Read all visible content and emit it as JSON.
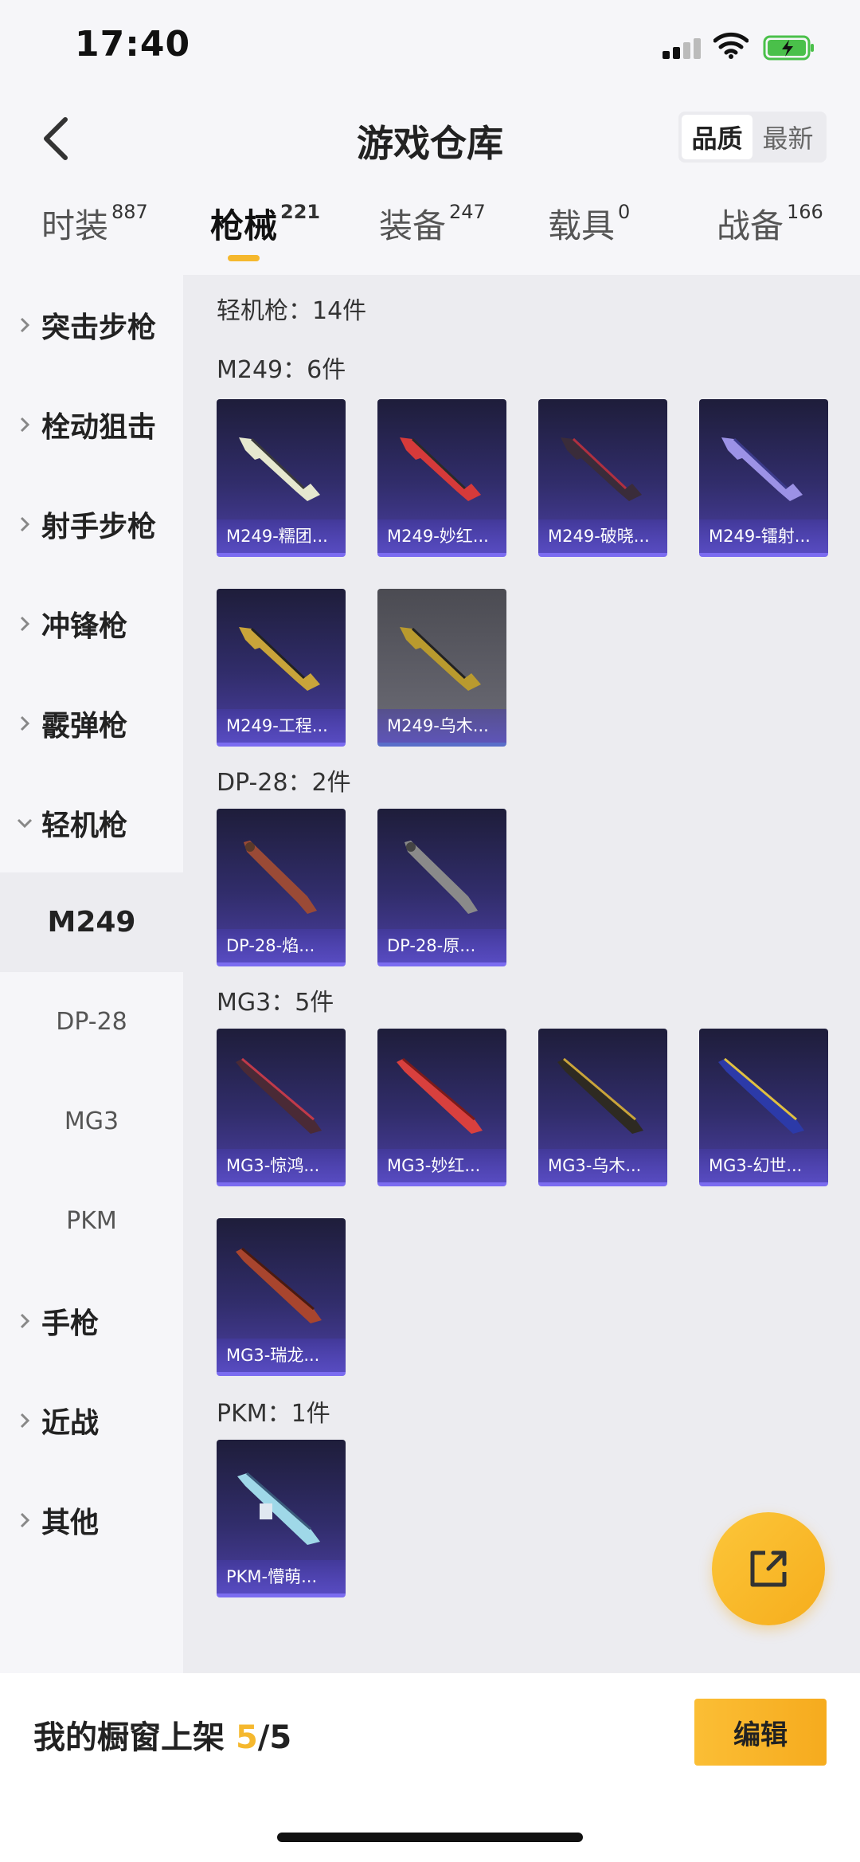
{
  "status_bar": {
    "time": "17:40"
  },
  "header": {
    "title": "游戏仓库",
    "sort_options": [
      "品质",
      "最新"
    ]
  },
  "tabs": [
    {
      "label": "时装",
      "count": "887"
    },
    {
      "label": "枪械",
      "count": "221"
    },
    {
      "label": "装备",
      "count": "247"
    },
    {
      "label": "载具",
      "count": "0"
    },
    {
      "label": "战备",
      "count": "166"
    }
  ],
  "sidebar": {
    "categories": [
      "突击步枪",
      "栓动狙击",
      "射手步枪",
      "冲锋枪",
      "霰弹枪",
      "轻机枪"
    ],
    "sub_items": [
      "M249",
      "DP-28",
      "MG3",
      "PKM"
    ],
    "more": [
      "手枪",
      "近战",
      "其他"
    ]
  },
  "content": {
    "summary": "轻机枪：14件",
    "groups": [
      {
        "title": "M249：6件",
        "items": [
          "M249-糯团...",
          "M249-妙红...",
          "M249-破晓...",
          "M249-镭射...",
          "M249-工程...",
          "M249-乌木..."
        ]
      },
      {
        "title": "DP-28：2件",
        "items": [
          "DP-28-焰...",
          "DP-28-原..."
        ]
      },
      {
        "title": "MG3：5件",
        "items": [
          "MG3-惊鸿...",
          "MG3-妙红...",
          "MG3-乌木...",
          "MG3-幻世...",
          "MG3-瑞龙..."
        ]
      },
      {
        "title": "PKM：1件",
        "items": [
          "PKM-懵萌..."
        ]
      }
    ]
  },
  "bottom": {
    "label": "我的橱窗上架",
    "current": "5",
    "total": "/5",
    "edit": "编辑"
  },
  "icons": [
    "back-arrow-icon",
    "share-icon",
    "chevron-right-icon",
    "chevron-down-icon",
    "signal-icon",
    "wifi-icon",
    "battery-icon"
  ],
  "colors": {
    "accent": "#f5b82e",
    "card_purple": "#312d6b",
    "card_grey": "#5f5f68"
  }
}
